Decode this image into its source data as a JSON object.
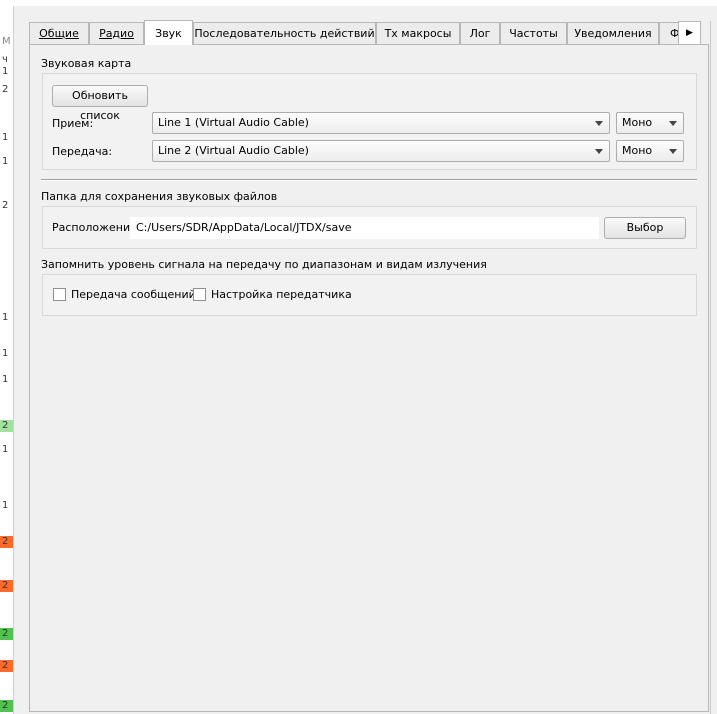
{
  "tabs": [
    {
      "label": "Общие",
      "active": false
    },
    {
      "label": "Радио",
      "active": false
    },
    {
      "label": "Звук",
      "active": true
    },
    {
      "label": "Последовательность действий",
      "active": false
    },
    {
      "label": "Tx макросы",
      "active": false
    },
    {
      "label": "Лог",
      "active": false
    },
    {
      "label": "Частоты",
      "active": false
    },
    {
      "label": "Уведомления",
      "active": false
    },
    {
      "label": "Ф",
      "active": false
    }
  ],
  "tab_scroll_icon": "chevron-right-icon",
  "soundcard": {
    "title": "Звуковая карта",
    "refresh_button": "Обновить список",
    "input_label": "Прием:",
    "input_device": "Line 1 (Virtual Audio Cable)",
    "input_channel": "Моно",
    "output_label": "Передача:",
    "output_device": "Line 2 (Virtual Audio Cable)",
    "output_channel": "Моно"
  },
  "save_folder": {
    "title": "Папка для сохранения звуковых файлов",
    "location_label": "Расположение:",
    "location_value": "C:/Users/SDR/AppData/Local/JTDX/save",
    "browse_button": "Выбор"
  },
  "remember_power": {
    "title": "Запомнить уровень сигнала на передачу по диапазонам и видам излучения",
    "transmit_label": "Передача сообщений",
    "transmit_checked": false,
    "tune_label": "Настройка передатчика",
    "tune_checked": false
  },
  "left_strip": {
    "fragments": [
      "М",
      "ч",
      "1",
      "2",
      "1",
      "1",
      "2",
      "1",
      "1",
      "1",
      "2",
      "1",
      "1",
      "2",
      "2",
      "2",
      "2",
      "2"
    ]
  }
}
